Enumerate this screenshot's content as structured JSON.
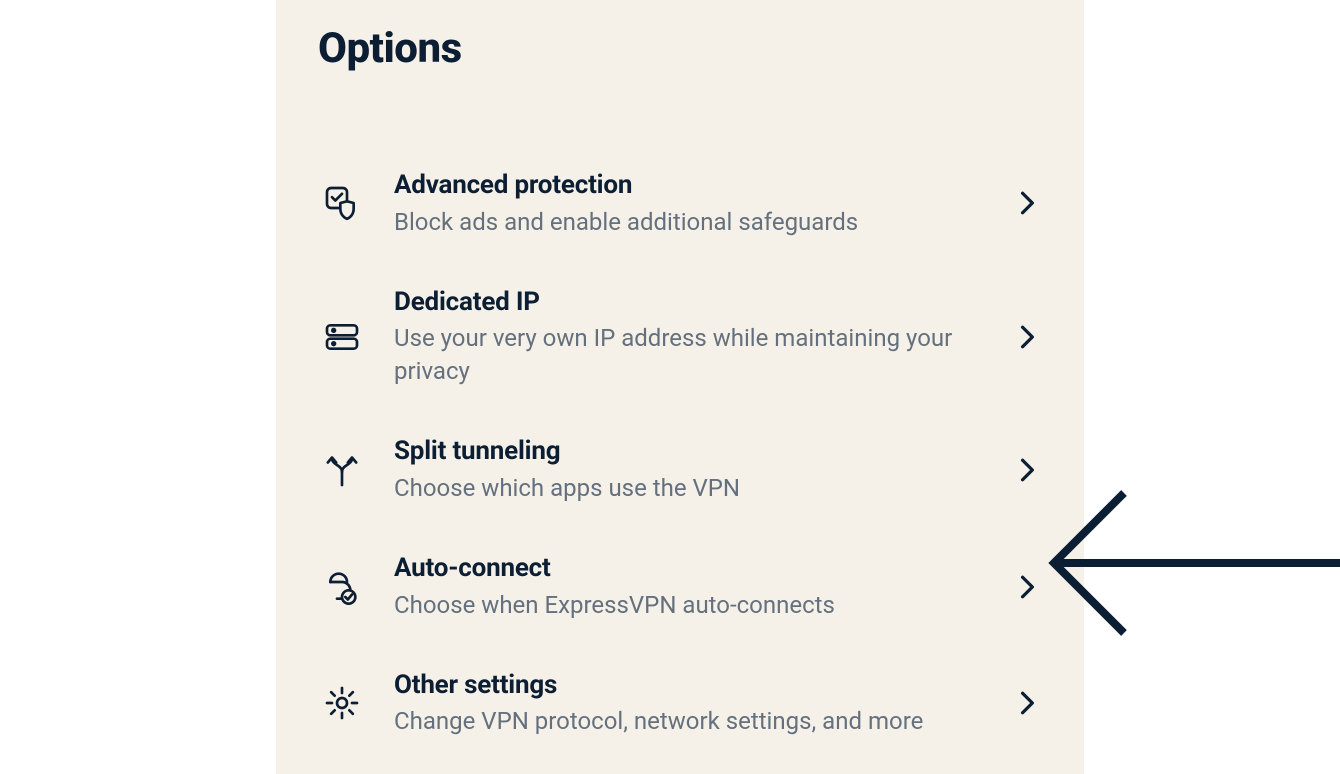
{
  "panel": {
    "title": "Options",
    "items": [
      {
        "icon": "shield-check-icon",
        "title": "Advanced protection",
        "subtitle": "Block ads and enable additional safeguards"
      },
      {
        "icon": "server-icon",
        "title": "Dedicated IP",
        "subtitle": "Use your very own IP address while maintaining your privacy"
      },
      {
        "icon": "split-arrows-icon",
        "title": "Split tunneling",
        "subtitle": "Choose which apps use the VPN"
      },
      {
        "icon": "autoconnect-icon",
        "title": "Auto-connect",
        "subtitle": "Choose when ExpressVPN auto-connects"
      },
      {
        "icon": "gear-icon",
        "title": "Other settings",
        "subtitle": "Change VPN protocol, network settings, and more"
      }
    ]
  },
  "annotation": {
    "arrow_target_index": 3
  },
  "colors": {
    "panel_bg": "#f6f1e8",
    "text_primary": "#0b1e33",
    "text_secondary": "#64707d"
  }
}
